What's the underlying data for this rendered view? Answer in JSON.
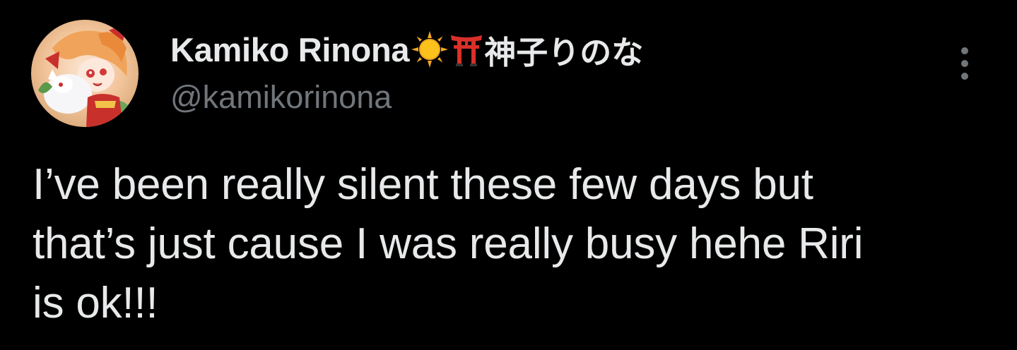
{
  "tweet": {
    "author": {
      "display_name": "Kamiko Rinona",
      "name_emojis": [
        "sun-emoji",
        "torii-emoji"
      ],
      "name_suffix": "神子りのな",
      "handle": "@kamikorinona"
    },
    "text_lines": [
      "I’ve been really silent these few days but",
      "that’s just cause I was really busy hehe Riri",
      "is ok!!!"
    ],
    "more_icon": "more-vertical-icon"
  },
  "colors": {
    "background": "#000000",
    "primary_text": "#e7e9ea",
    "secondary_text": "#71767b"
  }
}
